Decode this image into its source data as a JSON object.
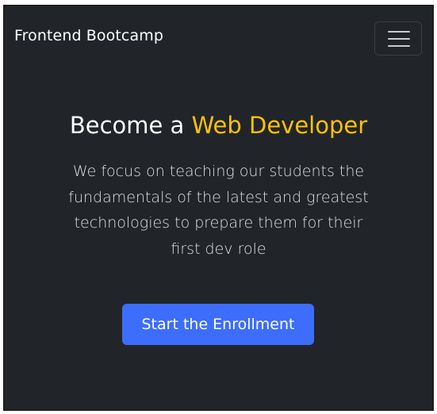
{
  "navbar": {
    "brand": "Frontend Bootcamp",
    "toggler_icon": "hamburger-menu-icon"
  },
  "hero": {
    "title_prefix": "Become a ",
    "title_highlight": "Web Developer",
    "lead": "We focus on teaching our students the fundamentals of the latest and greatest technologies to prepare them for their first dev role",
    "cta_label": "Start the Enrollment"
  },
  "colors": {
    "background": "#212529",
    "accent": "#ffc107",
    "primary": "#3d6dfd",
    "text": "#ffffff"
  }
}
